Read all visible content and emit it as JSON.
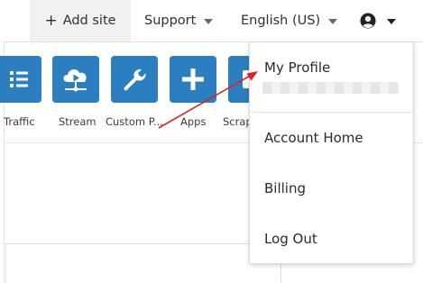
{
  "topnav": {
    "add_site": "Add site",
    "support": "Support",
    "language": "English (US)"
  },
  "tiles": [
    {
      "label": "Traffic",
      "icon": "list-icon"
    },
    {
      "label": "Stream",
      "icon": "cloud-play-icon"
    },
    {
      "label": "Custom P...",
      "icon": "wrench-icon"
    },
    {
      "label": "Apps",
      "icon": "plus-icon"
    },
    {
      "label": "Scrap",
      "icon": "scrape-shield-icon"
    }
  ],
  "account_menu": {
    "profile": "My Profile",
    "account_home": "Account Home",
    "billing": "Billing",
    "log_out": "Log Out"
  },
  "colors": {
    "tile_blue": "#2b7fc0",
    "annotation_red": "#e02020"
  }
}
